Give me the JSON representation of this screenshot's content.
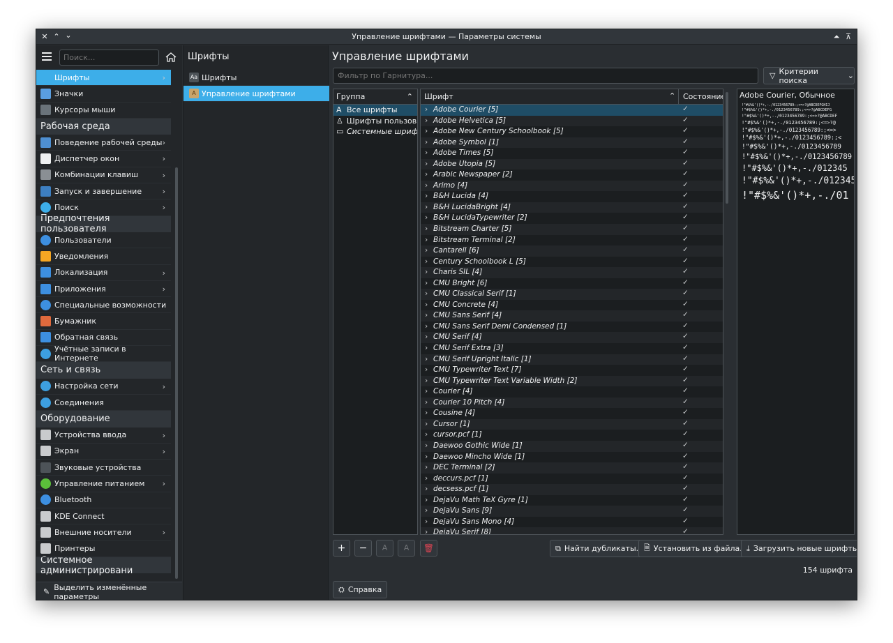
{
  "window": {
    "title": "Управление шрифтами — Параметры системы"
  },
  "sidebar": {
    "search_placeholder": "Поиск...",
    "items": [
      {
        "label": "Шрифты",
        "active": true,
        "chevron": true,
        "icon": "fonts-icon",
        "color": "#3daee9"
      },
      {
        "label": "Значки",
        "chevron": false,
        "icon": "icons-icon",
        "color": "#5a9ee0"
      },
      {
        "label": "Курсоры мыши",
        "chevron": false,
        "icon": "cursor-icon",
        "color": "#6a737a"
      },
      {
        "cat": "Рабочая среда"
      },
      {
        "label": "Поведение рабочей среды",
        "chevron": true,
        "icon": "desktop-icon",
        "color": "#4e8fd1"
      },
      {
        "label": "Диспетчер окон",
        "chevron": true,
        "icon": "window-icon",
        "color": "#eff0f1"
      },
      {
        "label": "Комбинации клавиш",
        "chevron": true,
        "icon": "keyboard-icon",
        "color": "#8a8f94"
      },
      {
        "label": "Запуск и завершение",
        "chevron": true,
        "icon": "startup-icon",
        "color": "#3d7fc1"
      },
      {
        "label": "Поиск",
        "chevron": true,
        "icon": "search-icon",
        "color": "#3daee9"
      },
      {
        "cat": "Предпочтения пользователя"
      },
      {
        "label": "Пользователи",
        "chevron": false,
        "icon": "users-icon",
        "color": "#3d8fe0"
      },
      {
        "label": "Уведомления",
        "chevron": false,
        "icon": "bell-icon",
        "color": "#f5a623"
      },
      {
        "label": "Локализация",
        "chevron": true,
        "icon": "locale-icon",
        "color": "#3d8fe0"
      },
      {
        "label": "Приложения",
        "chevron": true,
        "icon": "apps-icon",
        "color": "#3d8fe0"
      },
      {
        "label": "Специальные возможности",
        "chevron": false,
        "icon": "accessibility-icon",
        "color": "#3d8fe0"
      },
      {
        "label": "Бумажник",
        "chevron": false,
        "icon": "wallet-icon",
        "color": "#e06a3d"
      },
      {
        "label": "Обратная связь",
        "chevron": false,
        "icon": "feedback-icon",
        "color": "#3d8fe0"
      },
      {
        "label": "Учётные записи в Интернете",
        "chevron": false,
        "icon": "online-accounts-icon",
        "color": "#3d9fe0"
      },
      {
        "cat": "Сеть и связь"
      },
      {
        "label": "Настройка сети",
        "chevron": true,
        "icon": "network-icon",
        "color": "#3d9fe0"
      },
      {
        "label": "Соединения",
        "chevron": false,
        "icon": "connections-icon",
        "color": "#3d9fe0"
      },
      {
        "cat": "Оборудование"
      },
      {
        "label": "Устройства ввода",
        "chevron": true,
        "icon": "input-devices-icon",
        "color": "#c9cbcd"
      },
      {
        "label": "Экран",
        "chevron": true,
        "icon": "display-icon",
        "color": "#c9cbcd"
      },
      {
        "label": "Звуковые устройства",
        "chevron": false,
        "icon": "audio-icon",
        "color": "#4d5358"
      },
      {
        "label": "Управление питанием",
        "chevron": true,
        "icon": "power-icon",
        "color": "#5bbf3a"
      },
      {
        "label": "Bluetooth",
        "chevron": false,
        "icon": "bluetooth-icon",
        "color": "#3d8fe0"
      },
      {
        "label": "KDE Connect",
        "chevron": false,
        "icon": "kde-connect-icon",
        "color": "#c9cbcd"
      },
      {
        "label": "Внешние носители",
        "chevron": true,
        "icon": "usb-icon",
        "color": "#c9cbcd"
      },
      {
        "label": "Принтеры",
        "chevron": false,
        "icon": "printer-icon",
        "color": "#c9cbcd"
      },
      {
        "cat": "Системное администрировани"
      }
    ],
    "bottom_label": "Выделить изменённые параметры"
  },
  "middle": {
    "title": "Шрифты",
    "items": [
      {
        "label": "Шрифты",
        "active": false
      },
      {
        "label": "Управление шрифтами",
        "active": true
      }
    ]
  },
  "main": {
    "title": "Управление шрифтами",
    "filter_placeholder": "Фильтр по Гарнитура...",
    "criteria_label": "Критерии поиска",
    "group_header": "Группа",
    "groups": [
      {
        "label": "Все шрифты",
        "active": true,
        "icon": "A"
      },
      {
        "label": "Шрифты пользов...",
        "active": false,
        "icon": "user"
      },
      {
        "label": "Системные шриф...",
        "active": false,
        "icon": "monitor"
      }
    ],
    "font_header": "Шрифт",
    "status_header": "Состояние",
    "fonts": [
      "Adobe Courier [5]",
      "Adobe Helvetica [5]",
      "Adobe New Century Schoolbook [5]",
      "Adobe Symbol [1]",
      "Adobe Times [5]",
      "Adobe Utopia [5]",
      "Arabic Newspaper [2]",
      "Arimo [4]",
      "B&H Lucida [4]",
      "B&H LucidaBright [4]",
      "B&H LucidaTypewriter [2]",
      "Bitstream Charter [5]",
      "Bitstream Terminal [2]",
      "Cantarell [6]",
      "Century Schoolbook L [5]",
      "Charis SIL [4]",
      "CMU Bright [6]",
      "CMU Classical Serif [1]",
      "CMU Concrete [4]",
      "CMU Sans Serif [4]",
      "CMU Sans Serif Demi Condensed [1]",
      "CMU Serif [4]",
      "CMU Serif Extra [3]",
      "CMU Serif Upright Italic [1]",
      "CMU Typewriter Text [7]",
      "CMU Typewriter Text Variable Width [2]",
      "Courier [4]",
      "Courier 10 Pitch [4]",
      "Cousine [4]",
      "Cursor [1]",
      "cursor.pcf [1]",
      "Daewoo Gothic Wide [1]",
      "Daewoo Mincho Wide [1]",
      "DEC Terminal [2]",
      "deccurs.pcf [1]",
      "decsess.pcf [1]",
      "DejaVu Math TeX Gyre [1]",
      "DejaVu Sans [9]",
      "DejaVu Sans Mono [4]",
      "DejaVu Serif [8]"
    ],
    "check_glyph": "✓",
    "preview_title": "Adobe Courier, Обычное",
    "preview_lines": [
      "!\"#$%&'()*+,-./0123456789:;<=>?@ABCDEFGHIJ",
      "!\"#$%&'()*+,-./0123456789:;<=>?@ABCDEFG",
      "!\"#$%&'()*+,-./0123456789:;<=>?@ABCDEF",
      "!\"#$%&'()*+,-./0123456789:;<=>?@",
      "!\"#$%&'()*+,-./0123456789:;<=>",
      "!\"#$%&'()*+,-./0123456789:;<",
      "!\"#$%&'()*+,-./0123456789",
      "!\"#$%&'()*+,-./0123456789",
      "!\"#$%&'()*+,-./012345",
      "!\"#$%&'()*+,-./012345",
      "!\"#$%&'()*+,-./01"
    ],
    "buttons": {
      "find_duplicates": "Найти дубликаты...",
      "install_from_file": "Установить из файла...",
      "get_new": "Загрузить новые шрифты..."
    },
    "count_label": "154 шрифта",
    "help_label": "Справка"
  },
  "colors": {
    "accent": "#3daee9",
    "selection": "#1f4d66",
    "delete": "#da4453"
  }
}
